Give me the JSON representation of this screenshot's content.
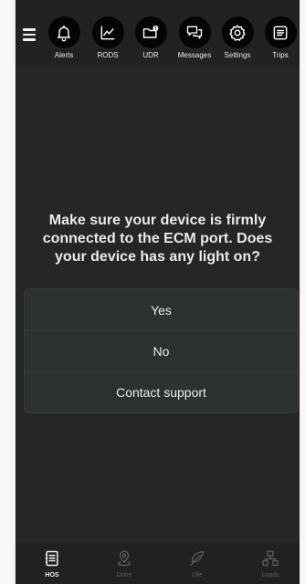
{
  "nav": {
    "items": [
      {
        "label": "Alerts",
        "icon": "bell-icon"
      },
      {
        "label": "RODS",
        "icon": "chart-line-icon"
      },
      {
        "label": "UDR",
        "icon": "folder-alert-icon"
      },
      {
        "label": "Messages",
        "icon": "chat-bubbles-icon"
      },
      {
        "label": "Settings",
        "icon": "gear-icon"
      },
      {
        "label": "Trips",
        "icon": "list-icon"
      }
    ]
  },
  "prompt": {
    "question": "Make sure your device is firmly connected to the ECM port. Does your device has any light on?",
    "options": [
      "Yes",
      "No",
      "Contact support"
    ]
  },
  "tabs": {
    "items": [
      {
        "label": "HOS",
        "icon": "logbook-icon",
        "active": true
      },
      {
        "label": "Drive",
        "icon": "map-pin-icon",
        "active": false
      },
      {
        "label": "Life",
        "icon": "leaf-icon",
        "active": false
      },
      {
        "label": "Loads",
        "icon": "hierarchy-icon",
        "active": false
      }
    ]
  },
  "colors": {
    "background": "#252626",
    "nav_circle": "#050505",
    "option_bg": "#2d3131",
    "active_tab": "#f2f2f2",
    "inactive_tab": "#5e6161"
  }
}
